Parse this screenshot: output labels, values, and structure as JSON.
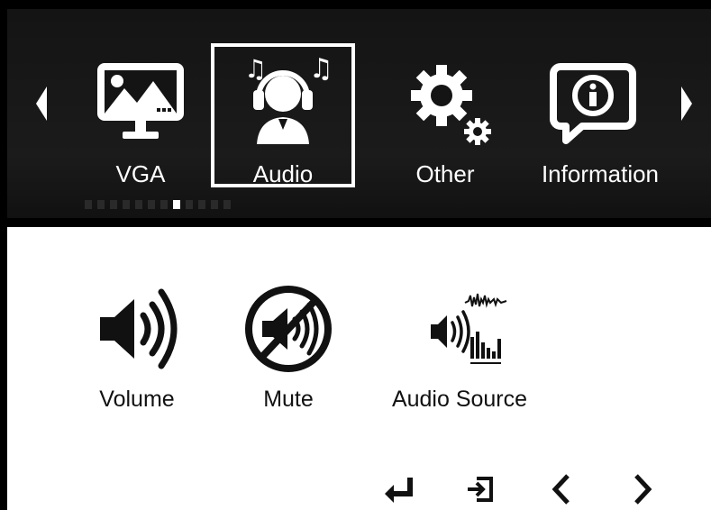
{
  "menu": {
    "tabs": [
      {
        "label": "VGA",
        "icon": "monitor-picture-icon"
      },
      {
        "label": "Audio",
        "icon": "headset-user-icon",
        "selected": true
      },
      {
        "label": "Other",
        "icon": "gears-icon"
      },
      {
        "label": "Information",
        "icon": "info-bubble-icon"
      }
    ],
    "page_dots": {
      "total": 12,
      "active_index": 7
    }
  },
  "audio_options": [
    {
      "label": "Volume",
      "icon": "speaker-volume-icon"
    },
    {
      "label": "Mute",
      "icon": "speaker-muted-icon"
    },
    {
      "label": "Audio Source",
      "icon": "audio-source-icon"
    }
  ],
  "keys": [
    {
      "icon": "enter-icon"
    },
    {
      "icon": "exit-icon"
    },
    {
      "icon": "left-chevron-icon"
    },
    {
      "icon": "right-chevron-icon"
    }
  ],
  "colors": {
    "menu_bg": "#141414",
    "highlight": "#ffffff",
    "panel_bg": "#ffffff",
    "text_dark": "#111111"
  }
}
